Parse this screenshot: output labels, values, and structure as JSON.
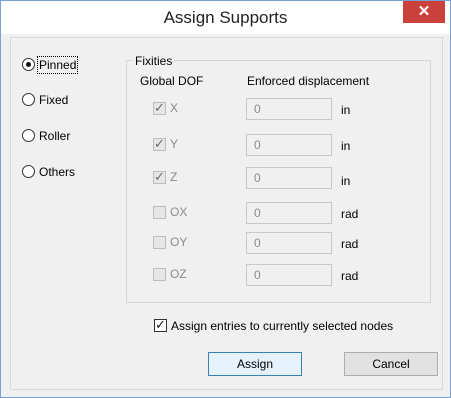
{
  "window": {
    "title": "Assign Supports",
    "close_glyph": "✕"
  },
  "support_types": [
    {
      "label": "Pinned",
      "selected": true
    },
    {
      "label": "Fixed",
      "selected": false
    },
    {
      "label": "Roller",
      "selected": false
    },
    {
      "label": "Others",
      "selected": false
    }
  ],
  "fixities": {
    "group_title": "Fixities",
    "col_dof": "Global DOF",
    "col_disp": "Enforced displacement",
    "rows": [
      {
        "dof": "X",
        "checked": true,
        "value": "0",
        "unit": "in"
      },
      {
        "dof": "Y",
        "checked": true,
        "value": "0",
        "unit": "in"
      },
      {
        "dof": "Z",
        "checked": true,
        "value": "0",
        "unit": "in"
      },
      {
        "dof": "OX",
        "checked": false,
        "value": "0",
        "unit": "rad"
      },
      {
        "dof": "OY",
        "checked": false,
        "value": "0",
        "unit": "rad"
      },
      {
        "dof": "OZ",
        "checked": false,
        "value": "0",
        "unit": "rad"
      }
    ]
  },
  "assign_selected": {
    "label": "Assign entries to currently selected nodes",
    "checked": true
  },
  "buttons": {
    "assign": "Assign",
    "cancel": "Cancel"
  }
}
